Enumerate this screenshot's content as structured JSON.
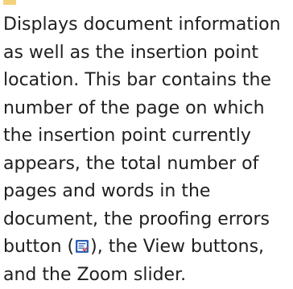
{
  "description": {
    "line1": "Displays document information",
    "line2": "as well as the insertion point",
    "line3": "location. This bar contains the",
    "line4": "number of the page on which",
    "line5": "the insertion point currently",
    "line6": "appears, the total number of",
    "line7": "pages and words in the",
    "line8": "document, the proofing errors",
    "line9_before_icon": "button (",
    "line9_after_icon": "), the View buttons,",
    "line10": "and the Zoom slider."
  },
  "icons": {
    "inline": "proofing-errors-icon"
  },
  "colors": {
    "text": "#1f1f1f",
    "icon_blue": "#2b5fb3",
    "top_mark": "#f4d27a"
  }
}
